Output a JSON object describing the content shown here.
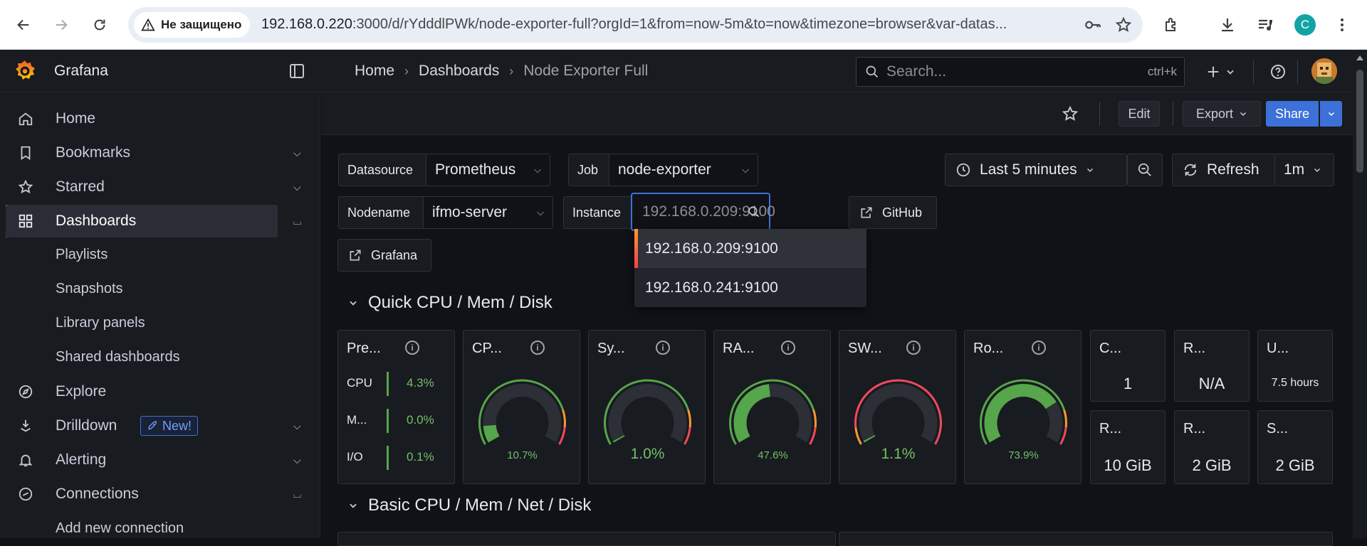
{
  "browser": {
    "security_label": "Не защищено",
    "url_host": "192.168.0.220",
    "url_rest": ":3000/d/rYdddlPWk/node-exporter-full?orgId=1&from=now-5m&to=now&timezone=browser&var-datas...",
    "profile_initial": "C"
  },
  "app": {
    "brand": "Grafana",
    "breadcrumb": [
      "Home",
      "Dashboards",
      "Node Exporter Full"
    ],
    "search_placeholder": "Search...",
    "search_shortcut": "ctrl+k"
  },
  "sidebar": {
    "items": [
      {
        "label": "Home"
      },
      {
        "label": "Bookmarks"
      },
      {
        "label": "Starred"
      },
      {
        "label": "Dashboards"
      },
      {
        "label": "Explore"
      },
      {
        "label": "Drilldown",
        "badge": "New!"
      },
      {
        "label": "Alerting"
      },
      {
        "label": "Connections"
      }
    ],
    "dashboards_children": [
      "Playlists",
      "Snapshots",
      "Library panels",
      "Shared dashboards"
    ],
    "connections_children": [
      "Add new connection"
    ]
  },
  "toolbar": {
    "edit": "Edit",
    "export": "Export",
    "share": "Share"
  },
  "variables": {
    "datasource_label": "Datasource",
    "datasource_value": "Prometheus",
    "job_label": "Job",
    "job_value": "node-exporter",
    "nodename_label": "Nodename",
    "nodename_value": "ifmo-server",
    "instance_label": "Instance",
    "instance_placeholder": "192.168.0.209:9100",
    "github_link": "GitHub",
    "grafana_link": "Grafana"
  },
  "time_controls": {
    "range": "Last 5 minutes",
    "refresh": "Refresh",
    "interval": "1m"
  },
  "instance_options": [
    "192.168.0.209:9100",
    "192.168.0.241:9100"
  ],
  "rows": {
    "row1": "Quick CPU / Mem / Disk",
    "row2": "Basic CPU / Mem / Net / Disk"
  },
  "panels": {
    "pressure": {
      "title": "Pre...",
      "rows": [
        {
          "label": "CPU",
          "value": "4.3%"
        },
        {
          "label": "M...",
          "value": "0.0%"
        },
        {
          "label": "I/O",
          "value": "0.1%"
        }
      ]
    },
    "gauges": [
      {
        "title": "CP...",
        "value_text": "10.7%",
        "value": 10.7
      },
      {
        "title": "Sy...",
        "value_text": "1.0%",
        "value": 1.0
      },
      {
        "title": "RA...",
        "value_text": "47.6%",
        "value": 47.6
      },
      {
        "title": "SW...",
        "value_text": "1.1%",
        "value": 1.1
      },
      {
        "title": "Ro...",
        "value_text": "73.9%",
        "value": 73.9
      }
    ],
    "stats_top": [
      {
        "title": "C...",
        "value": "1"
      },
      {
        "title": "R...",
        "value": "N/A"
      },
      {
        "title": "U...",
        "value": "7.5 hours"
      }
    ],
    "stats_bottom": [
      {
        "title": "R...",
        "value": "10 GiB"
      },
      {
        "title": "R...",
        "value": "2 GiB"
      },
      {
        "title": "S...",
        "value": "2 GiB"
      }
    ]
  },
  "colors": {
    "accent_blue": "#3d71d9",
    "ok_green": "#56a64b",
    "warn_orange": "#ff9830",
    "critical_red": "#f2495c"
  }
}
